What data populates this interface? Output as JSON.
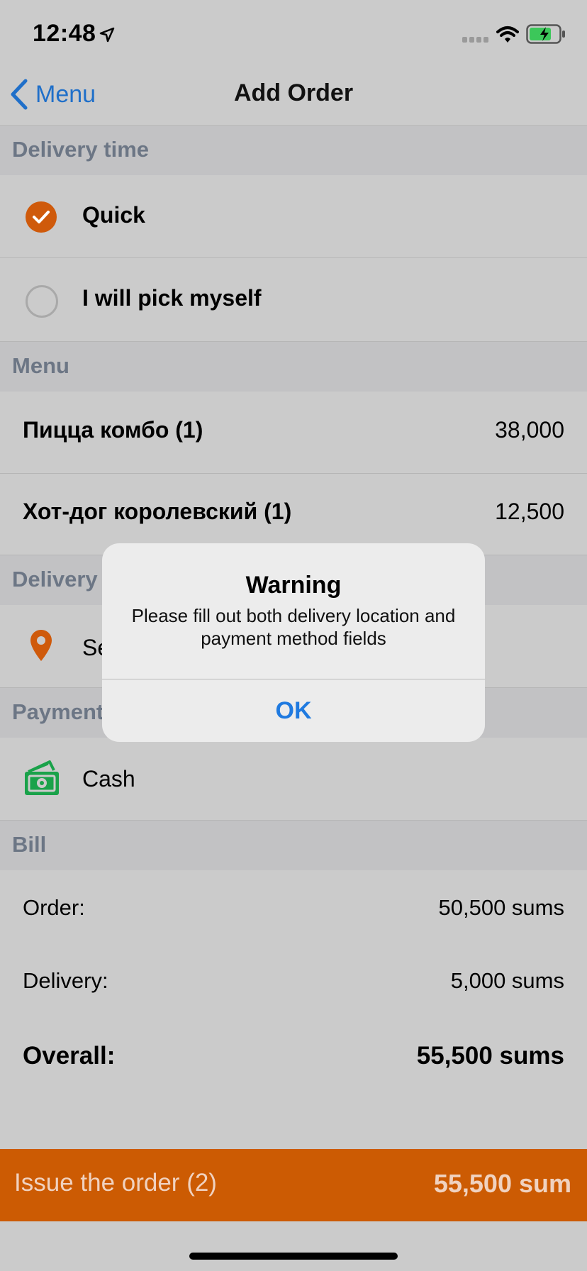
{
  "status_bar": {
    "time": "12:48"
  },
  "nav": {
    "back_label": "Menu",
    "title": "Add Order"
  },
  "delivery_time": {
    "header": "Delivery time",
    "options": [
      {
        "label": "Quick",
        "selected": true
      },
      {
        "label": "I will pick myself",
        "selected": false
      }
    ]
  },
  "menu": {
    "header": "Menu",
    "items": [
      {
        "name": "Пицца комбо (1)",
        "price": "38,000"
      },
      {
        "name": "Хот-дог королевский (1)",
        "price": "12,500"
      }
    ]
  },
  "delivery": {
    "header": "Delivery",
    "field_text": "Se"
  },
  "payment": {
    "header": "Payment",
    "method": "Cash"
  },
  "bill": {
    "header": "Bill",
    "order_label": "Order:",
    "order_value": "50,500 sums",
    "delivery_label": "Delivery:",
    "delivery_value": "5,000 sums",
    "overall_label": "Overall:",
    "overall_value": "55,500 sums"
  },
  "issue_bar": {
    "label": "Issue the order (2)",
    "total": "55,500 sum"
  },
  "alert": {
    "title": "Warning",
    "message": "Please fill out both delivery location and payment method fields",
    "ok_label": "OK"
  },
  "colors": {
    "accent": "#cc5b03",
    "link": "#1f6fc9",
    "pin": "#cf5a0b",
    "cash": "#1aa24a"
  }
}
